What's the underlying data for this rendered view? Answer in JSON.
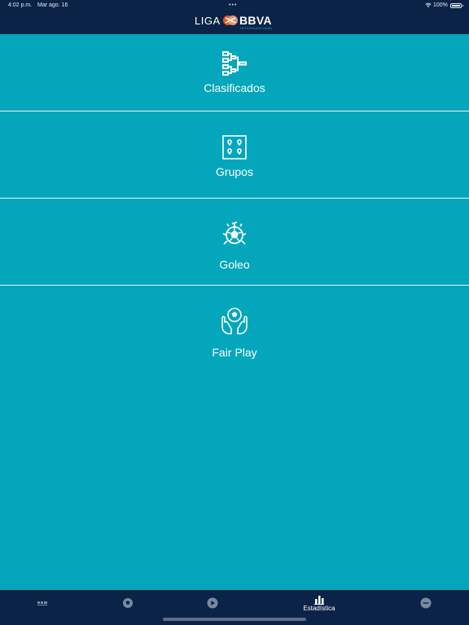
{
  "status_bar": {
    "time": "4:02 p.m.",
    "date": "Mar ago. 16",
    "dots": "•••",
    "battery": "100%"
  },
  "header": {
    "logo_text_left": "LIGA",
    "logo_text_right": "BBVA",
    "logo_subtext": "INTERNACIONAL"
  },
  "menu": {
    "items": [
      {
        "label": "Clasificados",
        "icon": "bracket-icon"
      },
      {
        "label": "Grupos",
        "icon": "groups-icon"
      },
      {
        "label": "Goleo",
        "icon": "goal-ball-icon"
      },
      {
        "label": "Fair Play",
        "icon": "fair-play-icon"
      }
    ]
  },
  "tabbar": {
    "active_label": "Estadística",
    "tabs": [
      {
        "icon": "table-icon"
      },
      {
        "icon": "ball-icon"
      },
      {
        "icon": "play-icon"
      },
      {
        "icon": "stats-icon",
        "label": "Estadística"
      },
      {
        "icon": "more-icon"
      }
    ]
  },
  "colors": {
    "background": "#04a6bb",
    "navy": "#0b2347",
    "white": "#ffffff",
    "logo_accent": "#ea5a1b"
  }
}
